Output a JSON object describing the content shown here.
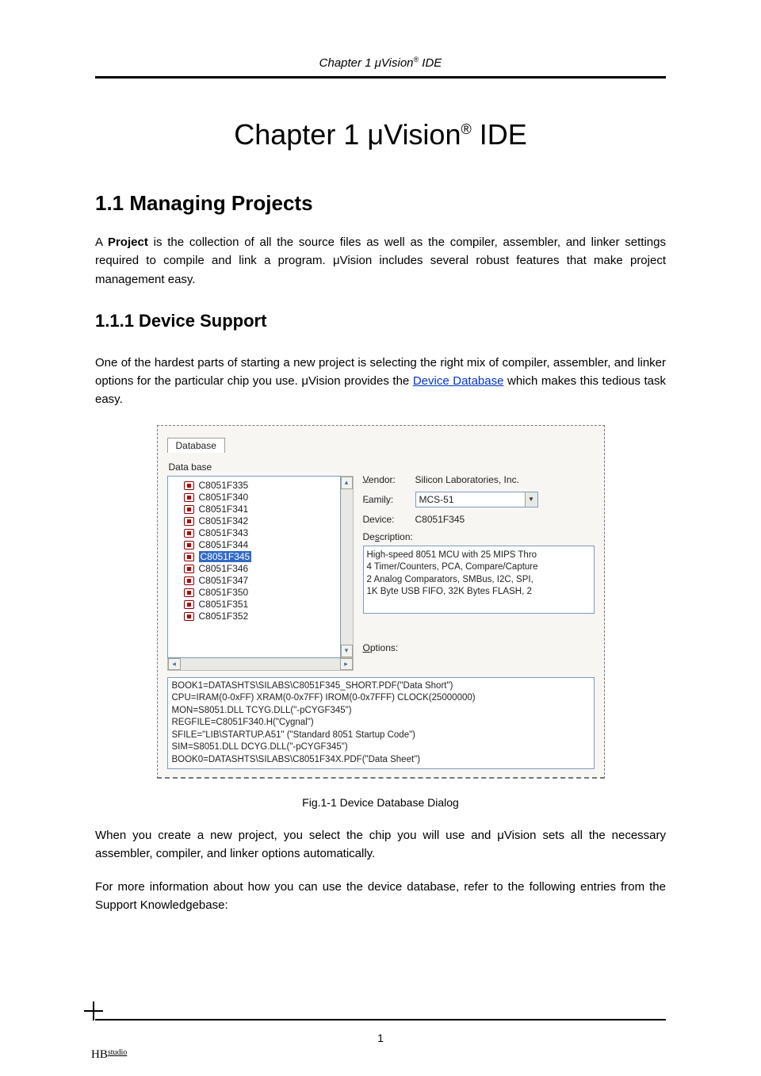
{
  "running_head": {
    "pre": "Chapter 1   μVision",
    "sup": "®",
    "post": " IDE"
  },
  "chapter_title": {
    "pre": "Chapter 1    μVision",
    "sup": "®",
    "post": " IDE"
  },
  "section_1_1": "1.1    Managing Projects",
  "para1_a": "A ",
  "para1_bold": "Project",
  "para1_b": " is the collection of all the source files as well as the compiler, assembler, and linker settings required to compile and link a program. μVision includes several robust features that make project management easy.",
  "section_1_1_1": "1.1.1    Device Support",
  "para2_a": "One of the hardest parts of starting a new project is selecting the right mix of compiler, assembler, and linker options for the particular chip you use. μVision provides the ",
  "para2_link": "Device Database",
  "para2_b": " which makes this tedious task easy.",
  "dialog": {
    "tab": "Database",
    "list_title": "Data base",
    "items": [
      "C8051F335",
      "C8051F340",
      "C8051F341",
      "C8051F342",
      "C8051F343",
      "C8051F344",
      "C8051F345",
      "C8051F346",
      "C8051F347",
      "C8051F350",
      "C8051F351",
      "C8051F352"
    ],
    "selected_index": 6,
    "vendor_label": "Vendor:",
    "vendor_value": "Silicon Laboratories, Inc.",
    "family_label": "Family:",
    "family_value": "MCS-51",
    "device_label": "Device:",
    "device_value": "C8051F345",
    "desc_label": "Description:",
    "desc_lines": [
      "High-speed 8051 MCU with 25 MIPS Thro",
      "4 Timer/Counters, PCA, Compare/Capture",
      "2 Analog Comparators, SMBus, I2C, SPI, ",
      "1K Byte USB FIFO,  32K Bytes FLASH, 2"
    ],
    "options_label": "Options:",
    "options_lines": [
      "BOOK1=DATASHTS\\SILABS\\C8051F345_SHORT.PDF(\"Data Short\")",
      "CPU=IRAM(0-0xFF) XRAM(0-0x7FF) IROM(0-0x7FFF) CLOCK(25000000)",
      "MON=S8051.DLL TCYG.DLL(\"-pCYGF345\")",
      "REGFILE=C8051F340.H(\"Cygnal\")",
      "SFILE=\"LIB\\STARTUP.A51\" (\"Standard 8051 Startup Code\")",
      "SIM=S8051.DLL DCYG.DLL(\"-pCYGF345\")",
      "BOOK0=DATASHTS\\SILABS\\C8051F34X.PDF(\"Data Sheet\")"
    ]
  },
  "figure_caption": "Fig.1-1   Device Database Dialog",
  "para3": "When you create a new project, you select the chip you will use and μVision sets all the necessary assembler, compiler, and linker options automatically.",
  "para4": "For more information about how you can use the device database, refer to the following entries from the Support Knowledgebase:",
  "page_number": "1",
  "footer_brand_hb": "HB",
  "footer_brand_studio": "studio"
}
